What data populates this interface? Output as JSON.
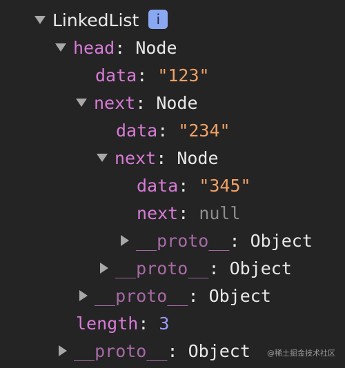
{
  "root": {
    "label": "LinkedList",
    "info_icon": "i"
  },
  "head": {
    "key": "head",
    "type": "Node"
  },
  "head_data": {
    "key": "data",
    "value": "\"123\""
  },
  "next1": {
    "key": "next",
    "type": "Node"
  },
  "next1_data": {
    "key": "data",
    "value": "\"234\""
  },
  "next2": {
    "key": "next",
    "type": "Node"
  },
  "next2_data": {
    "key": "data",
    "value": "\"345\""
  },
  "next3": {
    "key": "next",
    "value": "null"
  },
  "proto_next2": {
    "key": "__proto__",
    "type": "Object"
  },
  "proto_next1": {
    "key": "__proto__",
    "type": "Object"
  },
  "proto_head": {
    "key": "__proto__",
    "type": "Object"
  },
  "length": {
    "key": "length",
    "value": "3"
  },
  "proto_root": {
    "key": "__proto__",
    "type": "Object"
  },
  "watermark": "@稀土掘金技术社区",
  "colors": {
    "key": "#d77bd6",
    "string": "#f1a165",
    "number": "#9b9cfb",
    "null": "#8d8d8d",
    "background": "#242424"
  }
}
